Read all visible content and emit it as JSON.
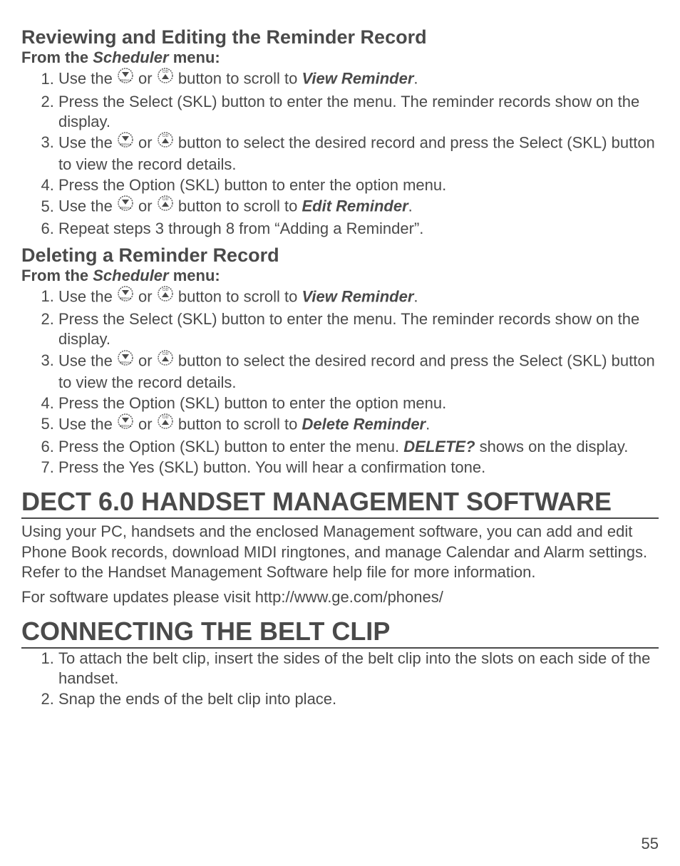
{
  "sec1": {
    "title": "Reviewing and Editing the Reminder Record",
    "subhead_pre": "From the ",
    "subhead_em": "Scheduler",
    "subhead_post": " menu:",
    "s1a": "Use the ",
    "s1b": " or ",
    "s1c": " button to scroll to ",
    "s1d": "View Reminder",
    "s1e": ".",
    "s2": "Press the Select (SKL) button to enter the menu. The reminder records show on the display.",
    "s3a": "Use the ",
    "s3b": " or ",
    "s3c": " button to select the desired record and press the Select (SKL) button to view the record details.",
    "s4": "Press the Option (SKL) button to enter the option menu.",
    "s5a": "Use the ",
    "s5b": " or ",
    "s5c": " button to scroll to ",
    "s5d": "Edit Reminder",
    "s5e": ".",
    "s6": "Repeat steps 3 through 8 from “Adding a Reminder”."
  },
  "sec2": {
    "title": "Deleting a Reminder Record",
    "subhead_pre": "From the ",
    "subhead_em": "Scheduler",
    "subhead_post": " menu:",
    "s1a": "Use the ",
    "s1b": " or ",
    "s1c": " button to scroll to ",
    "s1d": "View Reminder",
    "s1e": ".",
    "s2": "Press the Select (SKL) button to enter the menu. The reminder records show on the display.",
    "s3a": "Use the ",
    "s3b": " or ",
    "s3c": " button to select the desired record and press the Select (SKL) button to view the record details.",
    "s4": "Press the Option (SKL) button to enter the option menu.",
    "s5a": "Use the ",
    "s5b": " or ",
    "s5c": " button to scroll to ",
    "s5d": "Delete Reminder",
    "s5e": ".",
    "s6a": "Press the Option (SKL) button to enter the menu. ",
    "s6b": "DELETE?",
    "s6c": " shows on the display.",
    "s7": "Press the Yes (SKL) button. You will hear a confirmation tone."
  },
  "sec3": {
    "title": "DECT 6.0 HANDSET MANAGEMENT SOFTWARE",
    "p1": "Using your PC, handsets and the enclosed Management software, you can add and edit Phone Book records, download MIDI ringtones, and manage Calendar and Alarm settings. Refer to the Handset Management Software help file for more information.",
    "p2": "For software updates please visit http://www.ge.com/phones/"
  },
  "sec4": {
    "title": "CONNECTING THE BELT CLIP",
    "s1": "To attach the belt clip, insert the sides of the belt clip into the slots on each side of the handset.",
    "s2": "Snap the ends of the belt clip into place."
  },
  "page": "55"
}
